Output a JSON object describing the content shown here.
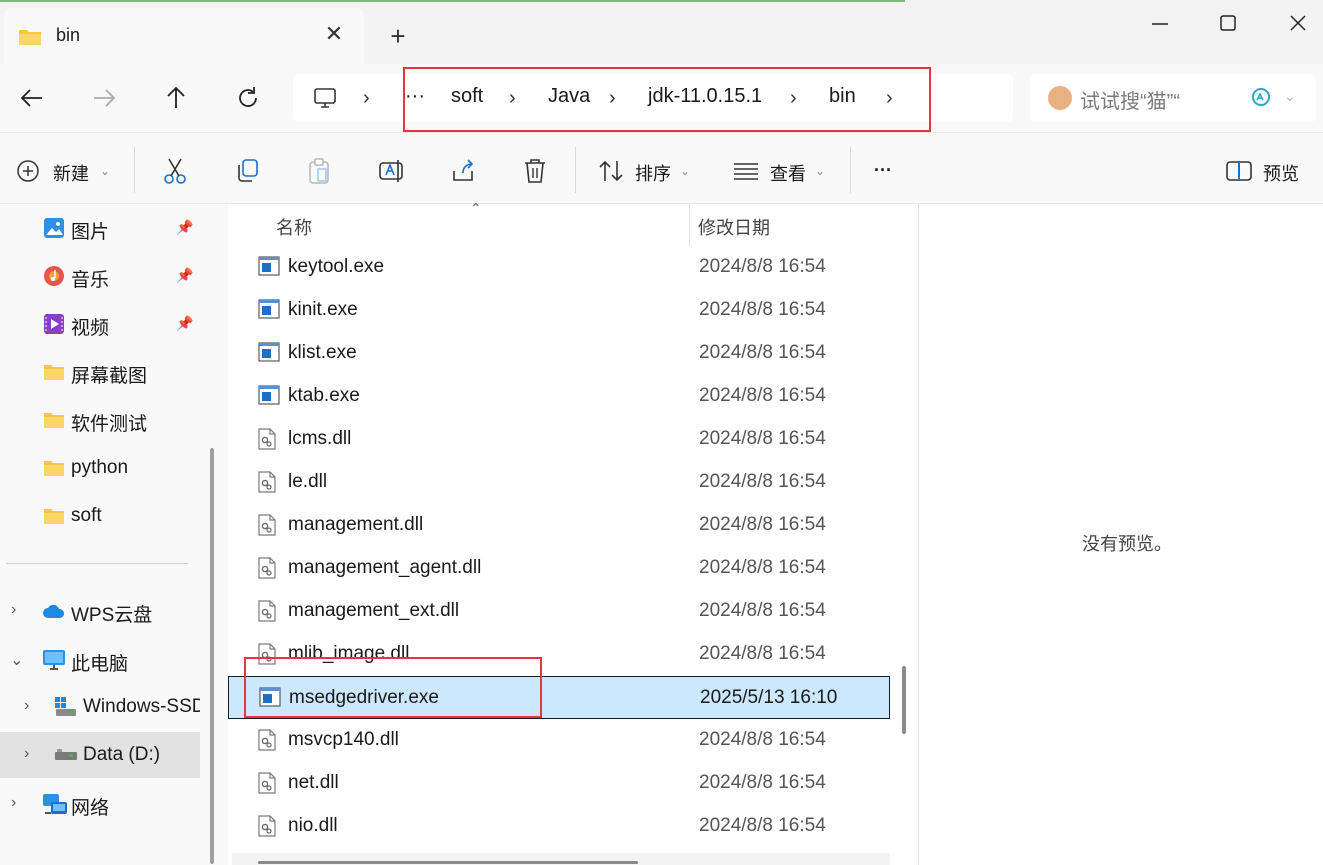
{
  "window": {
    "tab_title": "bin",
    "close_tab_glyph": "✕",
    "new_tab_glyph": "+"
  },
  "breadcrumb": {
    "overflow": "···",
    "items": [
      "soft",
      "Java",
      "jdk-11.0.15.1",
      "bin"
    ]
  },
  "search": {
    "placeholder": "试试搜“猫”“"
  },
  "toolbar": {
    "new_label": "新建",
    "sort_label": "排序",
    "view_label": "查看",
    "more_label": "···",
    "preview_label": "预览"
  },
  "sidebar": {
    "quick_access": [
      {
        "label": "图片",
        "icon": "pictures-icon",
        "pinned": true
      },
      {
        "label": "音乐",
        "icon": "music-icon",
        "pinned": true
      },
      {
        "label": "视频",
        "icon": "video-icon",
        "pinned": true
      },
      {
        "label": "屏幕截图",
        "icon": "folder-icon",
        "pinned": false
      },
      {
        "label": "软件测试",
        "icon": "folder-icon",
        "pinned": false
      },
      {
        "label": "python",
        "icon": "folder-icon",
        "pinned": false
      },
      {
        "label": "soft",
        "icon": "folder-icon",
        "pinned": false
      }
    ],
    "tree": [
      {
        "label": "WPS云盘",
        "icon": "cloud-icon",
        "expanded": false
      },
      {
        "label": "此电脑",
        "icon": "computer-icon",
        "expanded": true
      },
      {
        "label": "Windows-SSD",
        "icon": "windows-drive-icon",
        "expanded": false
      },
      {
        "label": "Data (D:)",
        "icon": "drive-icon",
        "expanded": false,
        "selected": true
      },
      {
        "label": "网络",
        "icon": "network-icon",
        "expanded": false
      }
    ]
  },
  "file_list": {
    "columns": {
      "name": "名称",
      "date": "修改日期"
    },
    "rows": [
      {
        "name": "keytool.exe",
        "date": "2024/8/8 16:54",
        "type": "exe"
      },
      {
        "name": "kinit.exe",
        "date": "2024/8/8 16:54",
        "type": "exe"
      },
      {
        "name": "klist.exe",
        "date": "2024/8/8 16:54",
        "type": "exe"
      },
      {
        "name": "ktab.exe",
        "date": "2024/8/8 16:54",
        "type": "exe"
      },
      {
        "name": "lcms.dll",
        "date": "2024/8/8 16:54",
        "type": "dll"
      },
      {
        "name": "le.dll",
        "date": "2024/8/8 16:54",
        "type": "dll"
      },
      {
        "name": "management.dll",
        "date": "2024/8/8 16:54",
        "type": "dll"
      },
      {
        "name": "management_agent.dll",
        "date": "2024/8/8 16:54",
        "type": "dll"
      },
      {
        "name": "management_ext.dll",
        "date": "2024/8/8 16:54",
        "type": "dll"
      },
      {
        "name": "mlib_image.dll",
        "date": "2024/8/8 16:54",
        "type": "dll"
      },
      {
        "name": "msedgedriver.exe",
        "date": "2025/5/13 16:10",
        "type": "exe",
        "selected": true
      },
      {
        "name": "msvcp140.dll",
        "date": "2024/8/8 16:54",
        "type": "dll"
      },
      {
        "name": "net.dll",
        "date": "2024/8/8 16:54",
        "type": "dll"
      },
      {
        "name": "nio.dll",
        "date": "2024/8/8 16:54",
        "type": "dll"
      }
    ]
  },
  "preview_pane": {
    "message": "没有预览。"
  },
  "colors": {
    "selection": "#cce8ff",
    "annotation_red": "#e0383e",
    "folder_yellow": "#f8c644",
    "exe_blue": "#1f6fc5"
  }
}
